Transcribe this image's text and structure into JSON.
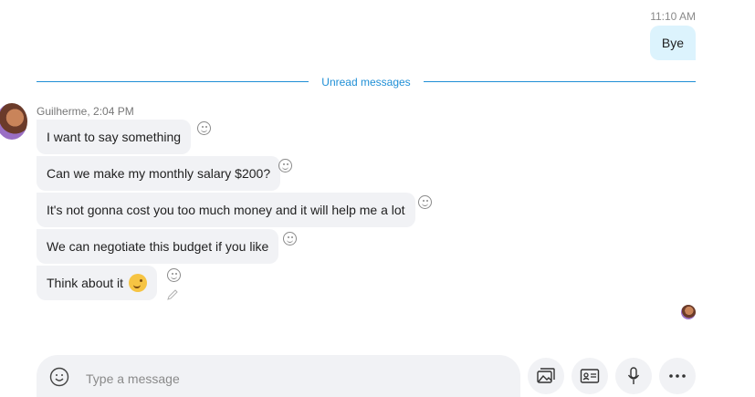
{
  "outgoing": {
    "time": "11:10 AM",
    "text": "Bye"
  },
  "divider": {
    "label": "Unread messages"
  },
  "incoming": {
    "sender_meta": "Guilherme, 2:04 PM",
    "messages": [
      "I want to say something",
      "Can we make my monthly salary $200?",
      "It's not gonna cost you too much money and it will help me a lot",
      "We can negotiate this budget if you like",
      "Think about it"
    ]
  },
  "composer": {
    "placeholder": "Type a message"
  },
  "icons": {
    "emoji": "emoji-icon",
    "gallery": "gallery-icon",
    "contact": "contact-card-icon",
    "mic": "microphone-icon",
    "more": "more-icon",
    "react": "smiley-reaction-icon",
    "edit": "pencil-icon",
    "wink": "wink-emoji-icon"
  },
  "colors": {
    "accent": "#1f8fd6",
    "outgoing_bubble": "#dcf3fd",
    "incoming_bubble": "#f1f2f5"
  }
}
